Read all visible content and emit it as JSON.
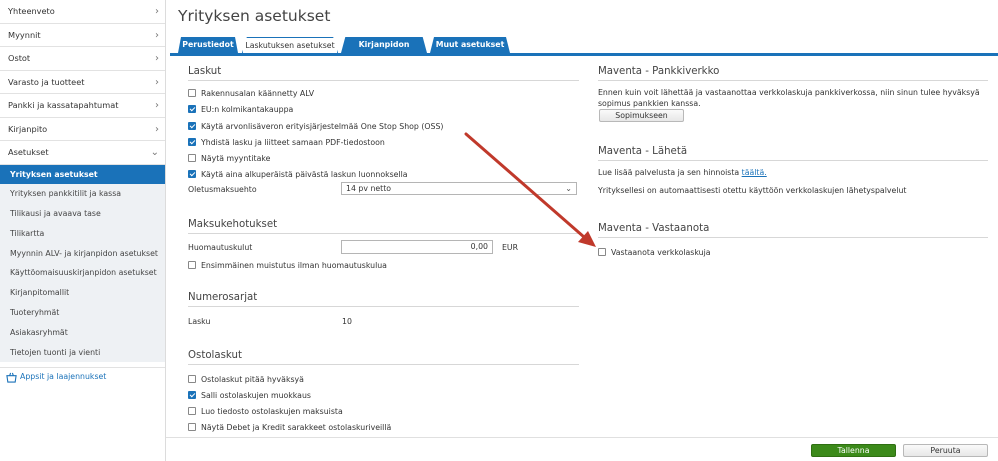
{
  "sidebar": {
    "nav": [
      {
        "label": "Yhteenveto",
        "chevron": "›"
      },
      {
        "label": "Myynnit",
        "chevron": "›"
      },
      {
        "label": "Ostot",
        "chevron": "›"
      },
      {
        "label": "Varasto ja tuotteet",
        "chevron": "›"
      },
      {
        "label": "Pankki ja kassatapahtumat",
        "chevron": "›"
      },
      {
        "label": "Kirjanpito",
        "chevron": "›"
      },
      {
        "label": "Asetukset",
        "chevron": "⌄"
      }
    ],
    "sub": [
      {
        "label": "Yrityksen asetukset",
        "active": true
      },
      {
        "label": "Yrityksen pankkitilit ja kassa"
      },
      {
        "label": "Tilikausi ja avaava tase"
      },
      {
        "label": "Tilikartta"
      },
      {
        "label": "Myynnin ALV- ja kirjanpidon asetukset"
      },
      {
        "label": "Käyttöomaisuuskirjanpidon asetukset"
      },
      {
        "label": "Kirjanpitomallit"
      },
      {
        "label": "Tuoteryhmät"
      },
      {
        "label": "Asiakasryhmät"
      },
      {
        "label": "Tietojen tuonti ja vienti"
      }
    ],
    "apps_label": "Appsit ja laajennukset"
  },
  "page": {
    "title": "Yrityksen asetukset",
    "tabs": [
      "Perustiedot",
      "Laskutuksen asetukset",
      "Kirjanpidon asetukset",
      "Muut asetukset"
    ],
    "active_tab": "Laskutuksen asetukset"
  },
  "laskut": {
    "title": "Laskut",
    "checkboxes": [
      {
        "label": "Rakennusalan käännetty ALV",
        "checked": false
      },
      {
        "label": "EU:n kolmikantakauppa",
        "checked": true
      },
      {
        "label": "Käytä arvonlisäveron erityisjärjestelmää One Stop Shop (OSS)",
        "checked": true
      },
      {
        "label": "Yhdistä lasku ja liitteet samaan PDF-tiedostoon",
        "checked": true
      },
      {
        "label": "Näytä myyntitake",
        "checked": false
      },
      {
        "label": "Käytä aina alkuperäistä päivästä laskun luonnoksella",
        "checked": true
      }
    ],
    "payment_term_label": "Oletusmaksuehto",
    "payment_term_value": "14 pv netto"
  },
  "maksukehotukset": {
    "title": "Maksukehotukset",
    "fee_label": "Huomautuskulut",
    "fee_value": "0,00",
    "currency": "EUR",
    "first_reminder_label": "Ensimmäinen muistutus ilman huomautuskulua",
    "first_reminder_checked": false
  },
  "numerosarjat": {
    "title": "Numerosarjat",
    "invoice_label": "Lasku",
    "invoice_value": "10"
  },
  "ostolaskut": {
    "title": "Ostolaskut",
    "checkboxes": [
      {
        "label": "Ostolaskut pitää hyväksyä",
        "checked": false
      },
      {
        "label": "Salli ostolaskujen muokkaus",
        "checked": true
      },
      {
        "label": "Luo tiedosto ostolaskujen maksuista",
        "checked": false
      },
      {
        "label": "Näytä Debet ja Kredit sarakkeet ostolaskuriveillä",
        "checked": false
      }
    ]
  },
  "maventa_pankki": {
    "title": "Maventa - Pankkiverkko",
    "text": "Ennen kuin voit lähettää ja vastaanottaa verkkolaskuja pankkiverkossa, niin sinun tulee hyväksyä sopimus pankkien kanssa.",
    "button": "Sopimukseen"
  },
  "maventa_laheta": {
    "title": "Maventa - Lähetä",
    "text": "Lue lisää palvelusta ja sen hinnoista",
    "link": "täältä.",
    "status": "Yrityksellesi on automaattisesti otettu käyttöön verkkolaskujen lähetyspalvelut"
  },
  "maventa_vastaanota": {
    "title": "Maventa - Vastaanota",
    "checkbox_label": "Vastaanota verkkolaskuja",
    "checked": false
  },
  "footer": {
    "save": "Tallenna",
    "cancel": "Peruuta"
  },
  "colors": {
    "accent": "#1a72b9",
    "save": "#3c8a1a",
    "arrow": "#c0392b"
  }
}
